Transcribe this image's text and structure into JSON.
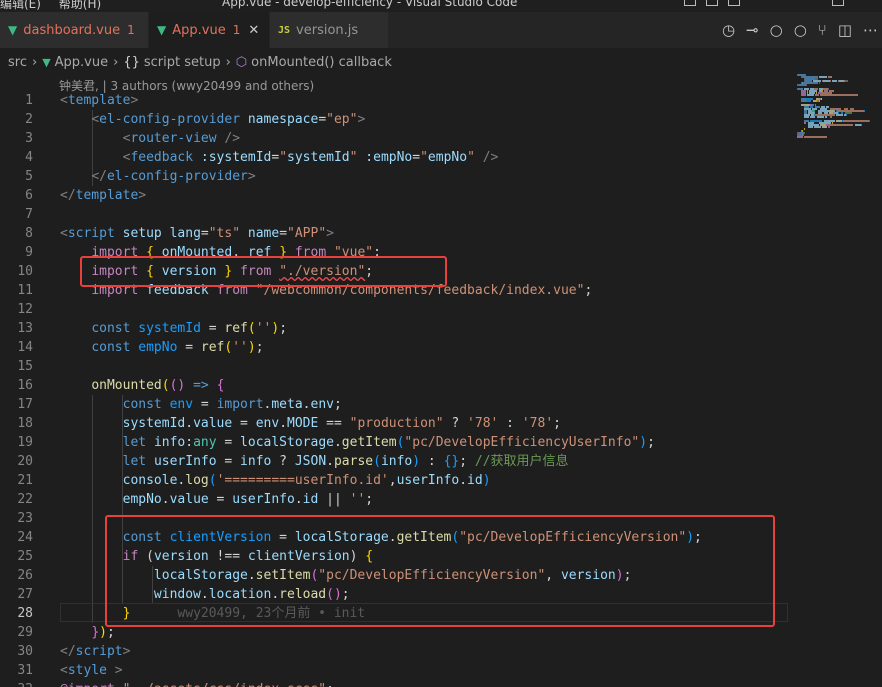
{
  "window": {
    "menu": [
      "编辑(E)",
      "帮助(H)"
    ],
    "title": "App.vue - develop-efficiency - Visual Studio Code"
  },
  "tabs": [
    {
      "name": "dashboard.vue",
      "badge": "1",
      "icon": "vue-icon",
      "modified": true,
      "active": false
    },
    {
      "name": "App.vue",
      "badge": "1",
      "icon": "vue-icon",
      "modified": true,
      "active": true
    },
    {
      "name": "version.js",
      "icon": "js-icon",
      "icon_text": "JS",
      "active": false
    }
  ],
  "toolbar": {
    "icons": [
      "timeline-icon",
      "compare-previous-icon",
      "previous-change-icon",
      "next-change-icon",
      "git-graph-icon",
      "split-editor-icon",
      "more-actions-icon"
    ]
  },
  "breadcrumb": {
    "items": [
      "src",
      "App.vue",
      "script setup",
      "onMounted() callback"
    ],
    "brace_glyph": "{}"
  },
  "codelens": "钟美君, | 3 authors (wwy20499 and others)",
  "editor": {
    "current_line": 28,
    "lines": [
      {
        "n": 1,
        "t": [
          [
            "<",
            "g"
          ],
          [
            "template",
            "t"
          ],
          [
            ">",
            "g"
          ]
        ]
      },
      {
        "n": 2,
        "t": [
          [
            "    "
          ],
          [
            "<",
            "g"
          ],
          [
            "el-config-provider",
            "t"
          ],
          [
            " "
          ],
          [
            "namespace",
            "a"
          ],
          [
            "=",
            "w"
          ],
          [
            "\"ep\"",
            "s"
          ],
          [
            ">",
            "g"
          ]
        ]
      },
      {
        "n": 3,
        "t": [
          [
            "        "
          ],
          [
            "<",
            "g"
          ],
          [
            "router-view",
            "t"
          ],
          [
            " />",
            "g"
          ]
        ]
      },
      {
        "n": 4,
        "t": [
          [
            "        "
          ],
          [
            "<",
            "g"
          ],
          [
            "feedback",
            "t"
          ],
          [
            " "
          ],
          [
            ":systemId",
            "a"
          ],
          [
            "=",
            "w"
          ],
          [
            "\"",
            "s"
          ],
          [
            "systemId",
            "v"
          ],
          [
            "\"",
            "s"
          ],
          [
            " "
          ],
          [
            ":empNo",
            "a"
          ],
          [
            "=",
            "w"
          ],
          [
            "\"",
            "s"
          ],
          [
            "empNo",
            "v"
          ],
          [
            "\"",
            "s"
          ],
          [
            " />",
            "g"
          ]
        ]
      },
      {
        "n": 5,
        "t": [
          [
            "    "
          ],
          [
            "</",
            "g"
          ],
          [
            "el-config-provider",
            "t"
          ],
          [
            ">",
            "g"
          ]
        ]
      },
      {
        "n": 6,
        "t": [
          [
            "</",
            "g"
          ],
          [
            "template",
            "t"
          ],
          [
            ">",
            "g"
          ]
        ]
      },
      {
        "n": 7,
        "t": []
      },
      {
        "n": 8,
        "t": [
          [
            "<",
            "g"
          ],
          [
            "script",
            "t"
          ],
          [
            " "
          ],
          [
            "setup",
            "a"
          ],
          [
            " "
          ],
          [
            "lang",
            "a"
          ],
          [
            "=",
            "w"
          ],
          [
            "\"ts\"",
            "s"
          ],
          [
            " "
          ],
          [
            "name",
            "a"
          ],
          [
            "=",
            "w"
          ],
          [
            "\"APP\"",
            "s"
          ],
          [
            ">",
            "g"
          ]
        ]
      },
      {
        "n": 9,
        "t": [
          [
            "    "
          ],
          [
            "import",
            "c"
          ],
          [
            " "
          ],
          [
            "{",
            "y"
          ],
          [
            " "
          ],
          [
            "onMounted",
            "v"
          ],
          [
            ", "
          ],
          [
            "ref",
            "v"
          ],
          [
            " "
          ],
          [
            "}",
            "y"
          ],
          [
            " "
          ],
          [
            "from",
            "c"
          ],
          [
            " "
          ],
          [
            "\"vue\"",
            "s"
          ],
          [
            ";",
            "w"
          ]
        ]
      },
      {
        "n": 10,
        "t": [
          [
            "    "
          ],
          [
            "import",
            "c"
          ],
          [
            " "
          ],
          [
            "{",
            "y"
          ],
          [
            " "
          ],
          [
            "version",
            "v"
          ],
          [
            " "
          ],
          [
            "}",
            "y"
          ],
          [
            " "
          ],
          [
            "from",
            "c"
          ],
          [
            " "
          ],
          [
            "\"./version\"",
            "s sq"
          ],
          [
            ";",
            "w"
          ]
        ]
      },
      {
        "n": 11,
        "t": [
          [
            "    "
          ],
          [
            "import",
            "c"
          ],
          [
            " "
          ],
          [
            "feedback",
            "v"
          ],
          [
            " "
          ],
          [
            "from",
            "c"
          ],
          [
            " "
          ],
          [
            "\"/webcommon/components/feedback/index.vue\"",
            "s"
          ],
          [
            ";",
            "w"
          ]
        ]
      },
      {
        "n": 12,
        "t": []
      },
      {
        "n": 13,
        "t": [
          [
            "    "
          ],
          [
            "const",
            "k"
          ],
          [
            " "
          ],
          [
            "systemId",
            "b"
          ],
          [
            " = "
          ],
          [
            "ref",
            "f"
          ],
          [
            "(",
            "y"
          ],
          [
            "''",
            "s"
          ],
          [
            ")",
            "y"
          ],
          [
            ";"
          ]
        ]
      },
      {
        "n": 14,
        "t": [
          [
            "    "
          ],
          [
            "const",
            "k"
          ],
          [
            " "
          ],
          [
            "empNo",
            "b"
          ],
          [
            " = "
          ],
          [
            "ref",
            "f"
          ],
          [
            "(",
            "y"
          ],
          [
            "''",
            "s"
          ],
          [
            ")",
            "y"
          ],
          [
            ";"
          ]
        ]
      },
      {
        "n": 15,
        "t": []
      },
      {
        "n": 16,
        "t": [
          [
            "    "
          ],
          [
            "onMounted",
            "f"
          ],
          [
            "(",
            "y"
          ],
          [
            "(",
            "m"
          ],
          [
            ")",
            "m"
          ],
          [
            " "
          ],
          [
            "=>",
            "k"
          ],
          [
            " "
          ],
          [
            "{",
            "m"
          ]
        ]
      },
      {
        "n": 17,
        "t": [
          [
            "        "
          ],
          [
            "const",
            "k"
          ],
          [
            " "
          ],
          [
            "env",
            "b"
          ],
          [
            " = "
          ],
          [
            "import",
            "k"
          ],
          [
            "."
          ],
          [
            "meta",
            "v"
          ],
          [
            "."
          ],
          [
            "env",
            "v"
          ],
          [
            ";"
          ]
        ]
      },
      {
        "n": 18,
        "t": [
          [
            "        "
          ],
          [
            "systemId",
            "v"
          ],
          [
            "."
          ],
          [
            "value",
            "v"
          ],
          [
            " = "
          ],
          [
            "env",
            "v"
          ],
          [
            "."
          ],
          [
            "MODE",
            "v"
          ],
          [
            " == "
          ],
          [
            "\"production\"",
            "s"
          ],
          [
            " ? "
          ],
          [
            "'78'",
            "s"
          ],
          [
            " : "
          ],
          [
            "'78'",
            "s"
          ],
          [
            ";"
          ]
        ]
      },
      {
        "n": 19,
        "t": [
          [
            "        "
          ],
          [
            "let",
            "k"
          ],
          [
            " "
          ],
          [
            "info",
            "v"
          ],
          [
            ":"
          ],
          [
            "any",
            "n"
          ],
          [
            " = "
          ],
          [
            "localStorage",
            "v"
          ],
          [
            "."
          ],
          [
            "getItem",
            "f"
          ],
          [
            "(",
            "b"
          ],
          [
            "\"pc/DevelopEfficiencyUserInfo\"",
            "s"
          ],
          [
            ")",
            "b"
          ],
          [
            ";"
          ]
        ]
      },
      {
        "n": 20,
        "t": [
          [
            "        "
          ],
          [
            "let",
            "k"
          ],
          [
            " "
          ],
          [
            "userInfo",
            "v"
          ],
          [
            " = "
          ],
          [
            "info",
            "v"
          ],
          [
            " ? "
          ],
          [
            "JSON",
            "v"
          ],
          [
            "."
          ],
          [
            "parse",
            "f"
          ],
          [
            "(",
            "b"
          ],
          [
            "info",
            "v"
          ],
          [
            ")",
            "b"
          ],
          [
            " : "
          ],
          [
            "{}",
            "b"
          ],
          [
            "; "
          ],
          [
            "//获取用户信息",
            "cm"
          ]
        ]
      },
      {
        "n": 21,
        "t": [
          [
            "        "
          ],
          [
            "console",
            "v"
          ],
          [
            "."
          ],
          [
            "log",
            "f"
          ],
          [
            "(",
            "b"
          ],
          [
            "'=========userInfo.id'",
            "s"
          ],
          [
            ","
          ],
          [
            "userInfo",
            "v"
          ],
          [
            "."
          ],
          [
            "id",
            "v"
          ],
          [
            ")",
            "b"
          ]
        ]
      },
      {
        "n": 22,
        "t": [
          [
            "        "
          ],
          [
            "empNo",
            "v"
          ],
          [
            "."
          ],
          [
            "value",
            "v"
          ],
          [
            " = "
          ],
          [
            "userInfo",
            "v"
          ],
          [
            "."
          ],
          [
            "id",
            "v"
          ],
          [
            " || "
          ],
          [
            "''",
            "s"
          ],
          [
            ";"
          ]
        ]
      },
      {
        "n": 23,
        "t": []
      },
      {
        "n": 24,
        "t": [
          [
            "        "
          ],
          [
            "const",
            "k"
          ],
          [
            " "
          ],
          [
            "clientVersion",
            "b"
          ],
          [
            " = "
          ],
          [
            "localStorage",
            "v"
          ],
          [
            "."
          ],
          [
            "getItem",
            "f"
          ],
          [
            "(",
            "b"
          ],
          [
            "\"pc/DevelopEfficiencyVersion\"",
            "s"
          ],
          [
            ")",
            "b"
          ],
          [
            ";"
          ]
        ]
      },
      {
        "n": 25,
        "t": [
          [
            "        "
          ],
          [
            "if",
            "c"
          ],
          [
            " ("
          ],
          [
            "version",
            "v"
          ],
          [
            " !== "
          ],
          [
            "clientVersion",
            "v"
          ],
          [
            ") "
          ],
          [
            "{",
            "y"
          ]
        ]
      },
      {
        "n": 26,
        "t": [
          [
            "            "
          ],
          [
            "localStorage",
            "v"
          ],
          [
            "."
          ],
          [
            "setItem",
            "f"
          ],
          [
            "(",
            "m"
          ],
          [
            "\"pc/DevelopEfficiencyVersion\"",
            "s"
          ],
          [
            ", "
          ],
          [
            "version",
            "v"
          ],
          [
            ")",
            "m"
          ],
          [
            ";"
          ]
        ]
      },
      {
        "n": 27,
        "t": [
          [
            "            "
          ],
          [
            "window",
            "v"
          ],
          [
            "."
          ],
          [
            "location",
            "v"
          ],
          [
            "."
          ],
          [
            "reload",
            "f"
          ],
          [
            "()",
            "m"
          ],
          [
            ";"
          ]
        ]
      },
      {
        "n": 28,
        "t": [
          [
            "        "
          ],
          [
            "}",
            "y"
          ],
          [
            "      "
          ],
          [
            "wwy20499, 23个月前 • init",
            "blame"
          ]
        ]
      },
      {
        "n": 29,
        "t": [
          [
            "    "
          ],
          [
            "}",
            "m"
          ],
          [
            ")",
            "y"
          ],
          [
            ";"
          ]
        ]
      },
      {
        "n": 30,
        "t": [
          [
            "</",
            "g"
          ],
          [
            "script",
            "t"
          ],
          [
            ">",
            "g"
          ]
        ]
      },
      {
        "n": 31,
        "t": [
          [
            "<",
            "g"
          ],
          [
            "style",
            "t"
          ],
          [
            " >",
            "g"
          ]
        ]
      },
      {
        "n": 32,
        "t": [
          [
            "@import",
            "c"
          ],
          [
            " "
          ],
          [
            "\"../assets/css/index.scss\"",
            "s"
          ],
          [
            ";"
          ]
        ]
      }
    ]
  },
  "colors": {
    "annotation_box": "#e8413b",
    "editor_bg": "#1e1e1e"
  }
}
